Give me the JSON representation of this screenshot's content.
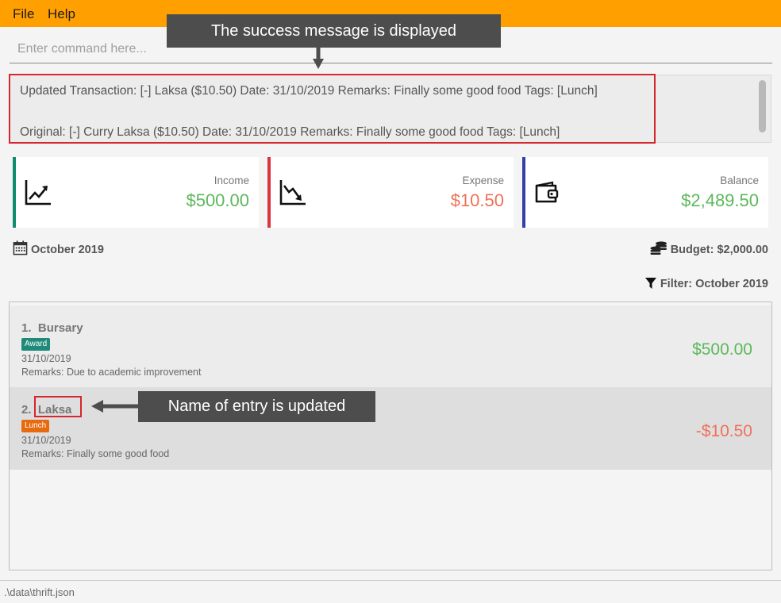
{
  "menu": {
    "file": "File",
    "help": "Help"
  },
  "command": {
    "placeholder": "Enter command here..."
  },
  "result": {
    "line1": "Updated Transaction: [-] Laksa ($10.50) Date: 31/10/2019 Remarks: Finally some good food Tags: [Lunch]",
    "line2": "Original: [-] Curry Laksa ($10.50) Date: 31/10/2019 Remarks: Finally some good food Tags: [Lunch]"
  },
  "cards": {
    "income": {
      "label": "Income",
      "value": "$500.00",
      "icon": "trend-up-icon"
    },
    "expense": {
      "label": "Expense",
      "value": "$10.50",
      "icon": "trend-down-icon"
    },
    "balance": {
      "label": "Balance",
      "value": "$2,489.50",
      "icon": "wallet-icon"
    }
  },
  "period": "October 2019",
  "budget": "Budget: $2,000.00",
  "filter": "Filter: October 2019",
  "transactions": [
    {
      "index": "1.",
      "name": "Bursary",
      "tag": "Award",
      "date": "31/10/2019",
      "remarks": "Remarks: Due to academic improvement",
      "amount": "$500.00"
    },
    {
      "index": "2.",
      "name": "Laksa",
      "tag": "Lunch",
      "date": "31/10/2019",
      "remarks": "Remarks: Finally some good food",
      "amount": "-$10.50"
    }
  ],
  "status": {
    "path": ".\\data\\thrift.json"
  },
  "annotations": {
    "success": "The success message is displayed",
    "name_updated": "Name of entry is updated"
  },
  "colors": {
    "menubar": "#ff9f00",
    "income": "#5cb85c",
    "expense": "#f0705a",
    "income_bar": "#138a72",
    "expense_bar": "#d9363e",
    "balance_bar": "#3340a8",
    "tag_award": "#1f8a7a",
    "tag_lunch": "#e86a10",
    "highlight": "#d6262e",
    "callout": "#4d4d4d"
  }
}
